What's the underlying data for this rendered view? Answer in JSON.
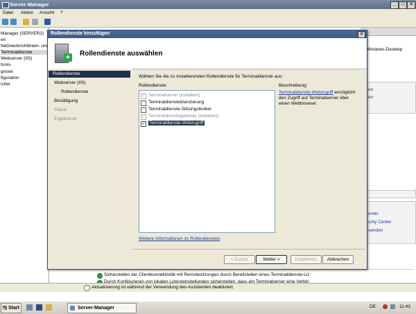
{
  "main_window": {
    "title": "Server-Manager",
    "menu": [
      "Datei",
      "Aktion",
      "Ansicht",
      "?"
    ],
    "tree": [
      {
        "label": "Manager (SERVER2)"
      },
      {
        "label": "en"
      },
      {
        "label": "Netzwerkrichtlinien- und"
      },
      {
        "label": "Terminaldienste"
      },
      {
        "label": "Webserver (IIS)"
      },
      {
        "label": "tures"
      },
      {
        "label": "gnose"
      },
      {
        "label": "figuration"
      },
      {
        "label": "icher"
      }
    ],
    "right_pane": {
      "partial_title": "Windows-Desktop",
      "links_top": [
        "en",
        "en"
      ],
      "links_bottom": [
        "enter",
        "urity Center",
        "senden"
      ]
    },
    "bottom": {
      "line1": "Sicherstellen der Clientkonnektivität mit Remotesitzungen durch Bereitstellen eines Terminaldienste-Liz",
      "line2": "Durch Konfigurieren von lokalen Lizenzeinstellungen sicherstellen, dass ein Terminalserver eine Verbin",
      "status": "Aktualisierung ist während der Verwendung des Assistenten deaktiviert."
    }
  },
  "dialog": {
    "title": "Rollendienste hinzufügen",
    "heading": "Rollendienste auswählen",
    "nav": [
      {
        "label": "Rollendienste",
        "state": "current"
      },
      {
        "label": "Webserver (IIS)",
        "state": "normal"
      },
      {
        "label": "Rollendienste",
        "state": "normal"
      },
      {
        "label": "Bestätigung",
        "state": "normal"
      },
      {
        "label": "Status",
        "state": "disabled"
      },
      {
        "label": "Ergebnisse",
        "state": "disabled"
      }
    ],
    "instruction": "Wählen Sie die zu installierenden Rollendienste für Terminaldienste aus:",
    "list_label": "Rollendienste:",
    "services": [
      {
        "label": "Terminalserver (installiert)",
        "checked": true,
        "disabled": true,
        "selected": false
      },
      {
        "label": "Terminaldienstelizenzierung",
        "checked": false,
        "disabled": false,
        "selected": false
      },
      {
        "label": "Terminaldienste-Sitzungsbroker",
        "checked": false,
        "disabled": false,
        "selected": false
      },
      {
        "label": "Terminaldienstegateway (installiert)",
        "checked": true,
        "disabled": true,
        "selected": false
      },
      {
        "label": "Terminaldienste-Webzugriff",
        "checked": true,
        "disabled": false,
        "selected": true
      }
    ],
    "description_label": "Beschreibung:",
    "description_link": "Terminaldienste-Webzugriff",
    "description_text": "ermöglicht den Zugriff auf Terminalserver über einen Webbrowser.",
    "more_info_link": "Weitere Informationen zu Rollendiensten",
    "buttons": {
      "back": "< Zurück",
      "next": "Weiter >",
      "install": "Installieren",
      "cancel": "Abbrechen"
    }
  },
  "taskbar": {
    "start": "Start",
    "task": "Server-Manager",
    "lang": "DE",
    "clock": "11:43"
  }
}
